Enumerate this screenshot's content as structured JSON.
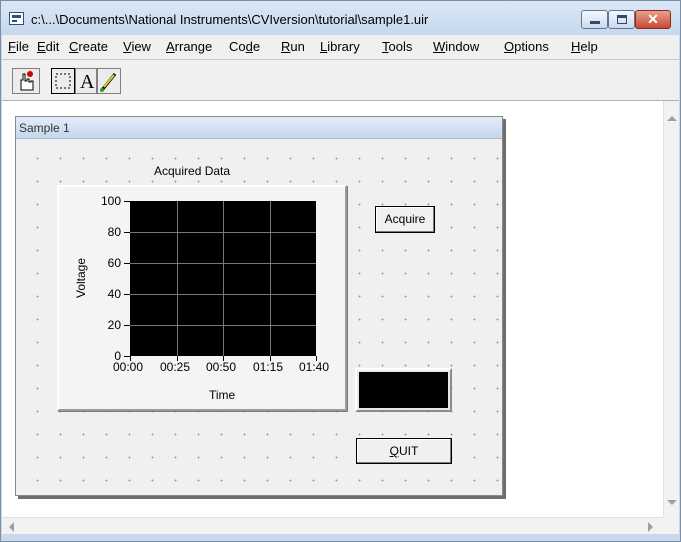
{
  "window": {
    "title": "c:\\...\\Documents\\National Instruments\\CVIversion\\tutorial\\sample1.uir",
    "close_glyph": "✕"
  },
  "menu": {
    "items": [
      {
        "underline": "F",
        "rest": "ile"
      },
      {
        "underline": "E",
        "rest": "dit"
      },
      {
        "underline": "C",
        "rest": "reate"
      },
      {
        "underline": "V",
        "rest": "iew"
      },
      {
        "underline": "A",
        "rest": "rrange"
      },
      {
        "pre": "Co",
        "underline": "d",
        "rest": "e"
      },
      {
        "underline": "R",
        "rest": "un"
      },
      {
        "underline": "L",
        "rest": "ibrary"
      },
      {
        "underline": "T",
        "rest": "ools"
      },
      {
        "underline": "W",
        "rest": "indow"
      },
      {
        "underline": "O",
        "rest": "ptions"
      },
      {
        "underline": "H",
        "rest": "elp"
      }
    ]
  },
  "toolbar": {
    "tools": [
      "operate-tool-icon",
      "select-tool-icon",
      "text-tool-icon",
      "color-tool-icon"
    ],
    "text_tool_glyph": "A"
  },
  "panel": {
    "title": "Sample 1"
  },
  "graph": {
    "title": "Acquired Data",
    "xlabel": "Time",
    "ylabel": "Voltage",
    "yticks": [
      "100",
      "80",
      "60",
      "40",
      "20",
      "0"
    ],
    "xticks": [
      "00:00",
      "00:25",
      "00:50",
      "01:15",
      "01:40"
    ],
    "ylim": [
      0,
      100
    ],
    "plot_color": "#000000",
    "grid_color": "#777777"
  },
  "buttons": {
    "acquire": "Acquire",
    "quit_underline": "Q",
    "quit_rest": "UIT"
  }
}
